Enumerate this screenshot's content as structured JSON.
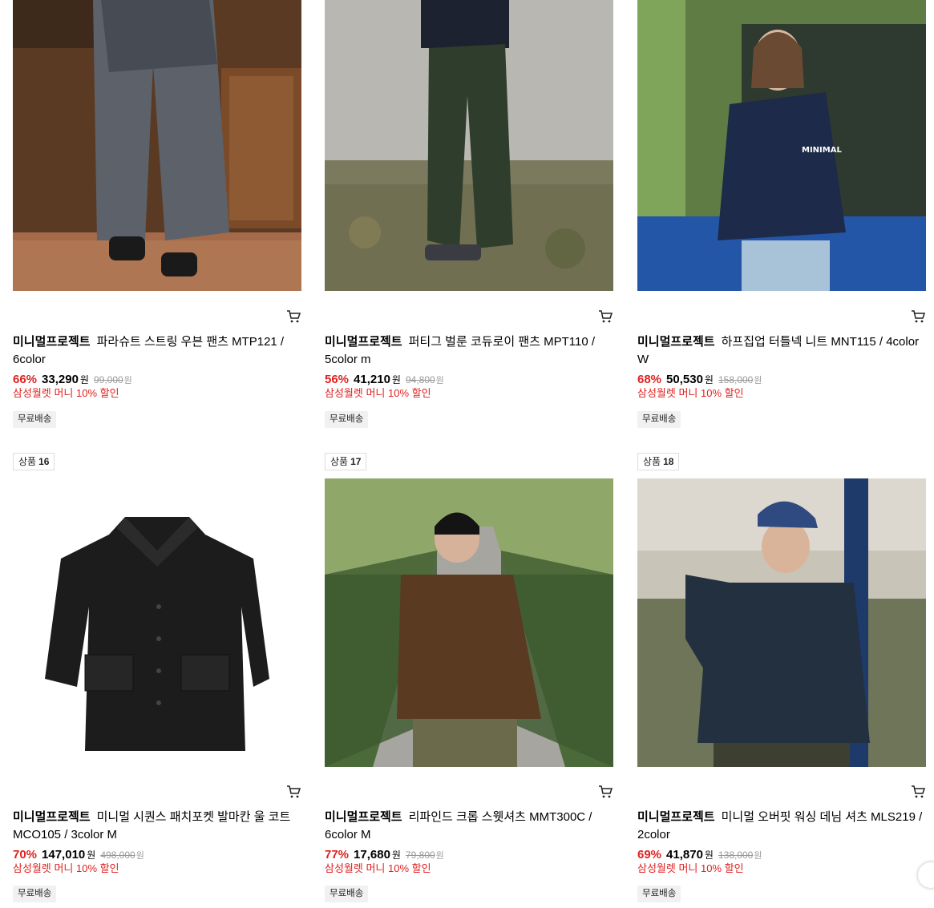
{
  "row1": [
    {
      "brand": "미니멀프로젝트",
      "name": "파라슈트 스트링 우븐 팬츠 MTP121 / 6color",
      "discount": "66%",
      "price": "33,290",
      "won": "원",
      "original": "99,000",
      "original_won": "원",
      "promo": "삼성월렛 머니 10% 할인",
      "shipping": "무료배송"
    },
    {
      "brand": "미니멀프로젝트",
      "name": "퍼티그 벌룬 코듀로이 팬츠 MPT110 / 5color m",
      "discount": "56%",
      "price": "41,210",
      "won": "원",
      "original": "94,800",
      "original_won": "원",
      "promo": "삼성월렛 머니 10% 할인",
      "shipping": "무료배송"
    },
    {
      "brand": "미니멀프로젝트",
      "name": "하프집업 터틀넥 니트 MNT115 / 4color W",
      "discount": "68%",
      "price": "50,530",
      "won": "원",
      "original": "158,000",
      "original_won": "원",
      "promo": "삼성월렛 머니 10% 할인",
      "shipping": "무료배송"
    }
  ],
  "row2": [
    {
      "badge_label": "상품",
      "badge_num": "16",
      "brand": "미니멀프로젝트",
      "name": "미니멀 시퀀스 패치포켓 발마칸 울 코트 MCO105 / 3color M",
      "discount": "70%",
      "price": "147,010",
      "won": "원",
      "original": "498,000",
      "original_won": "원",
      "promo": "삼성월렛 머니 10% 할인",
      "shipping": "무료배송"
    },
    {
      "badge_label": "상품",
      "badge_num": "17",
      "brand": "미니멀프로젝트",
      "name": "리파인드 크롭 스웻셔츠 MMT300C / 6color M",
      "discount": "77%",
      "price": "17,680",
      "won": "원",
      "original": "79,800",
      "original_won": "원",
      "promo": "삼성월렛 머니 10% 할인",
      "shipping": "무료배송"
    },
    {
      "badge_label": "상품",
      "badge_num": "18",
      "brand": "미니멀프로젝트",
      "name": "미니멀 오버핏 워싱 데님 셔츠 MLS219 / 2color",
      "discount": "69%",
      "price": "41,870",
      "won": "원",
      "original": "138,000",
      "original_won": "원",
      "promo": "삼성월렛 머니 10% 할인",
      "shipping": "무료배송"
    }
  ],
  "colors": {
    "discount": "#e02020",
    "promo": "#e02020",
    "strike": "#999999"
  },
  "icons": {
    "cart": "cart-icon"
  }
}
